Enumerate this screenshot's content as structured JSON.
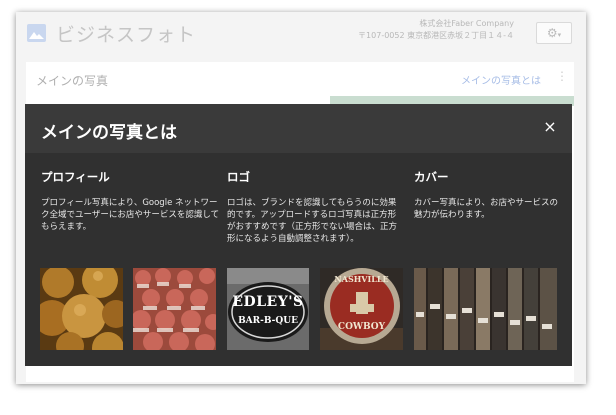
{
  "app": {
    "title": "ビジネスフォト",
    "company_name": "株式会社Faber Company",
    "company_address": "〒107-0052 東京都港区赤坂２丁目１４-４"
  },
  "card": {
    "title": "メインの写真",
    "link": "メインの写真とは",
    "more": "⋮"
  },
  "modal": {
    "title": "メインの写真とは",
    "close": "×",
    "sections": [
      {
        "title": "プロフィール",
        "desc": "プロフィール写真により、Google ネットワーク全域でユーザーにお店やサービスを認識してもらえます。"
      },
      {
        "title": "ロゴ",
        "desc": "ロゴは、ブランドを認識してもらうのに効果的です。アップロードするロゴ写真は正方形がおすすめです（正方形でない場合は、正方形になるよう自動調整されます）。"
      },
      {
        "title": "カバー",
        "desc": "カバー写真により、お店やサービスの魅力が伝わります。"
      }
    ],
    "photos": {
      "logo1_line1": "EDLEY'S",
      "logo1_line2": "BAR-B-QUE",
      "logo2_line1": "NASHVILLE",
      "logo2_line2": "COWBOY"
    }
  },
  "colors": {
    "modal_bg": "#303030",
    "modal_header": "#3a3a3a",
    "link": "#a6bce6"
  }
}
